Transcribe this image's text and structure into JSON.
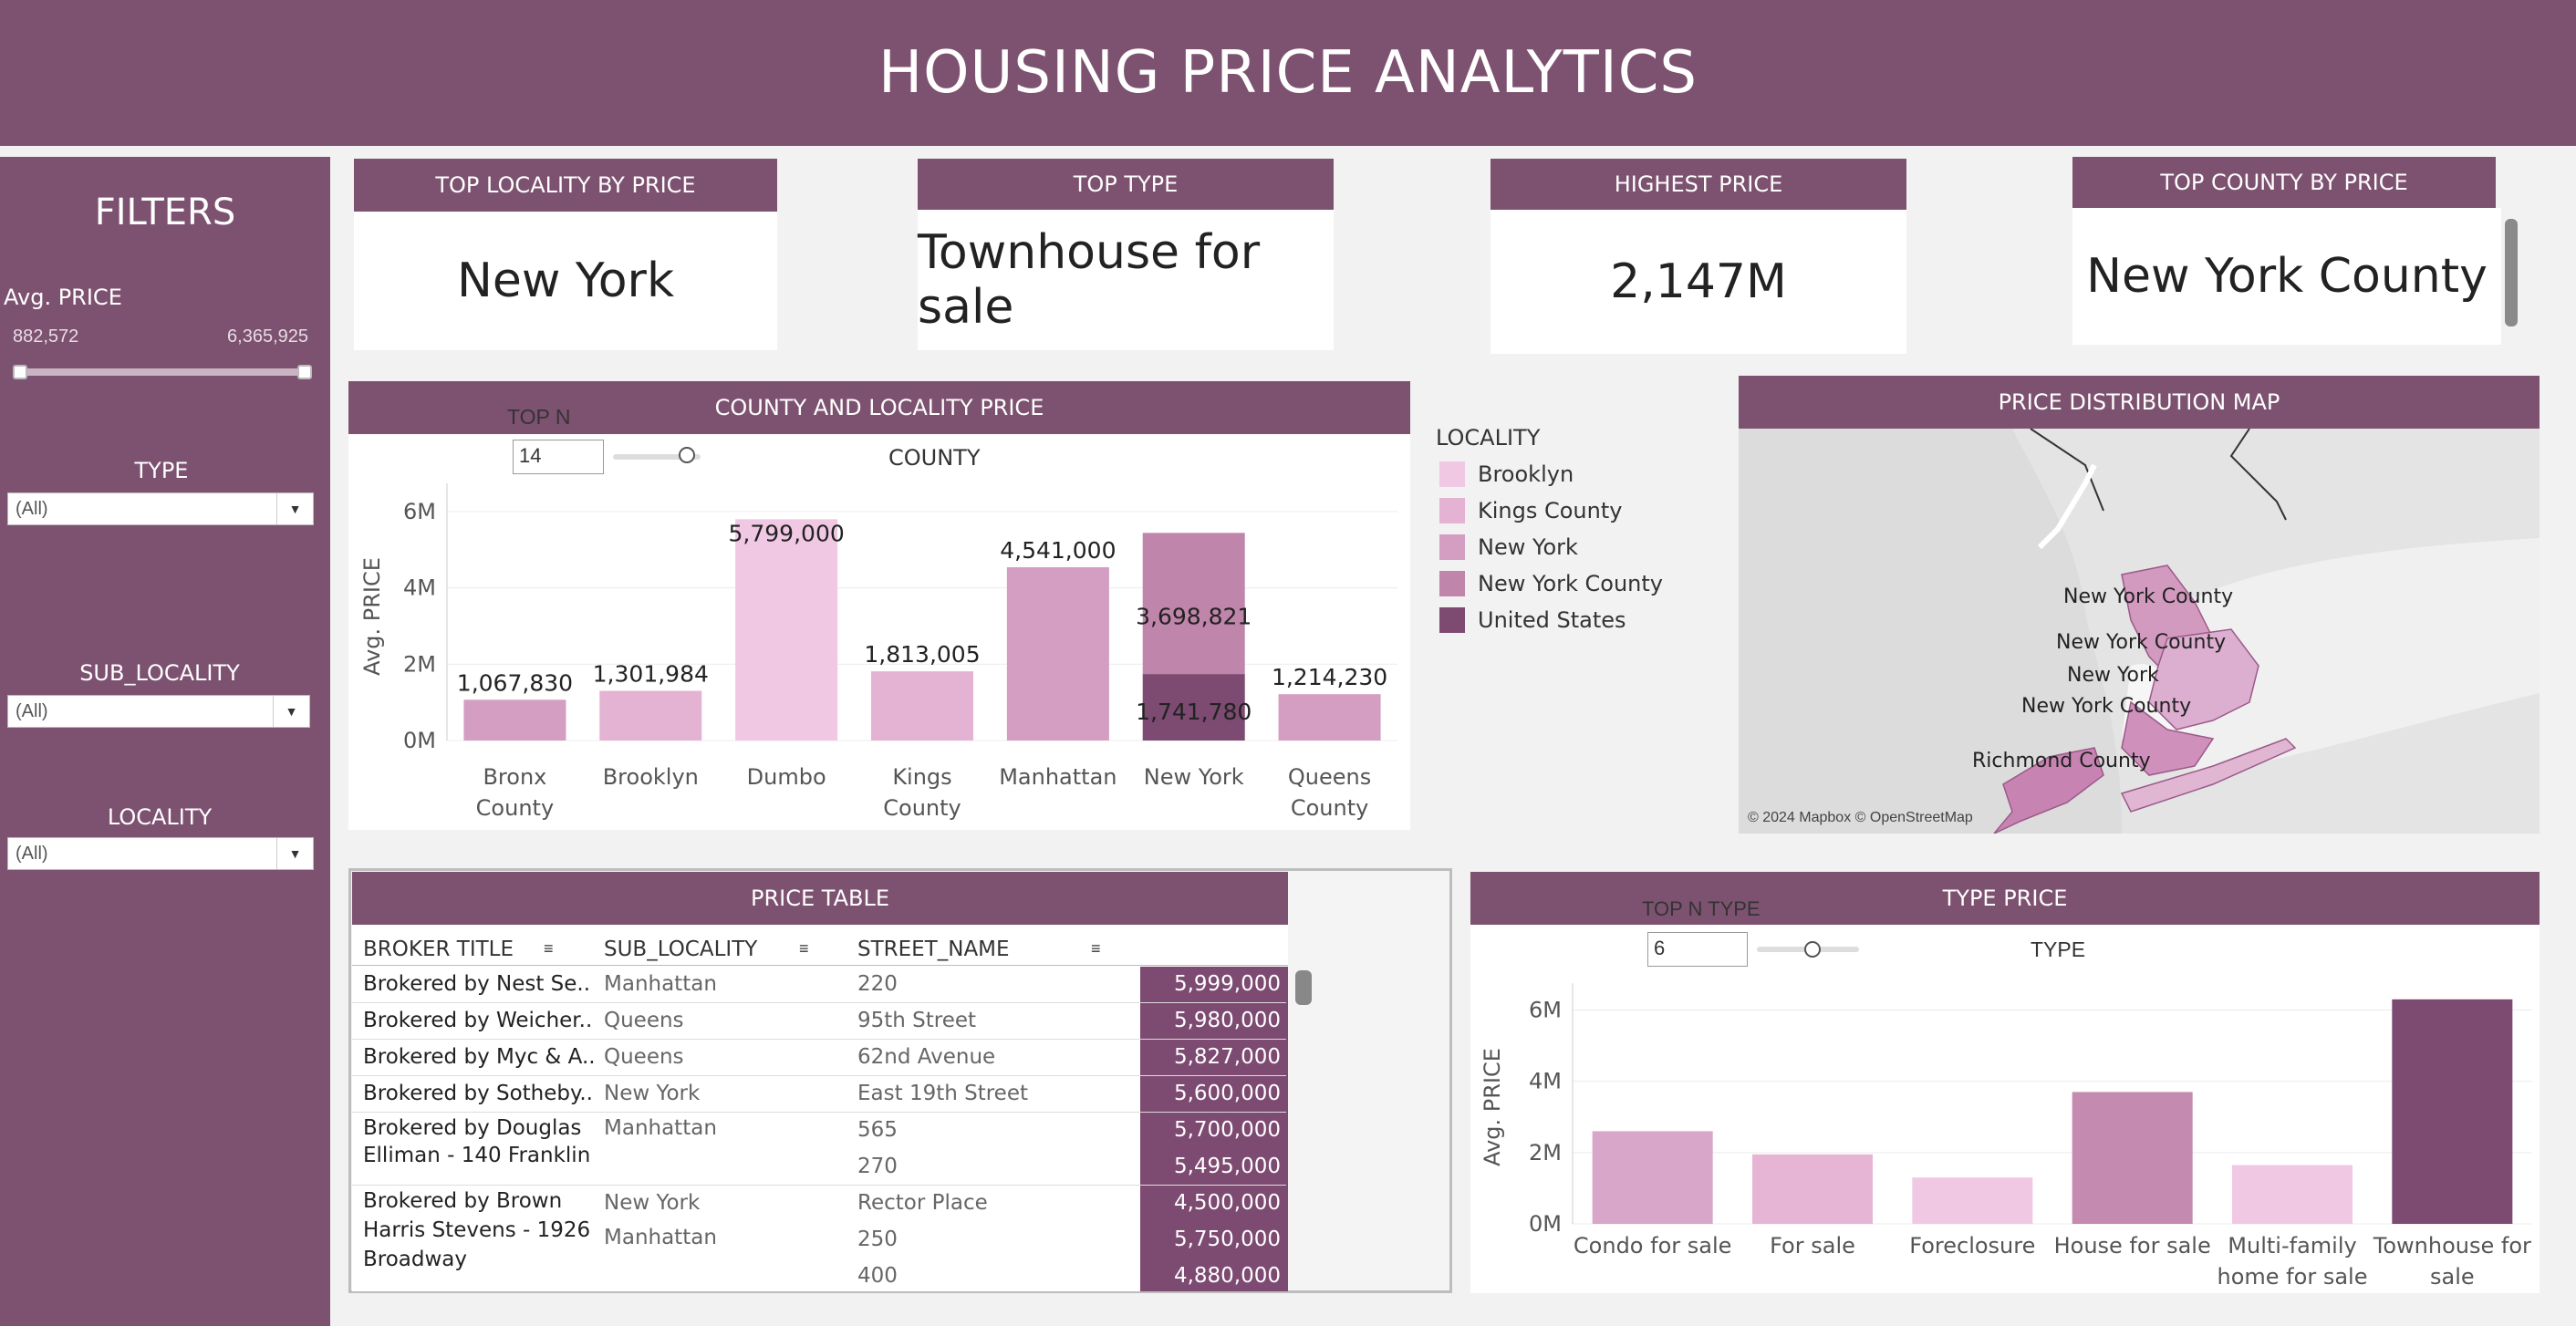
{
  "header": {
    "title": "HOUSING PRICE ANALYTICS"
  },
  "sidebar": {
    "title": "FILTERS",
    "price": {
      "label": "Avg. PRICE",
      "min": "882,572",
      "max": "6,365,925"
    },
    "type": {
      "label": "TYPE",
      "value": "(All)"
    },
    "sub_locality": {
      "label": "SUB_LOCALITY",
      "value": "(All)"
    },
    "locality": {
      "label": "LOCALITY",
      "value": "(All)"
    }
  },
  "kpis": [
    {
      "label": "TOP LOCALITY BY PRICE",
      "value": "New York"
    },
    {
      "label": "TOP TYPE",
      "value": "Townhouse for sale"
    },
    {
      "label": "HIGHEST PRICE",
      "value": "2,147M"
    },
    {
      "label": "TOP COUNTY BY PRICE",
      "value": "New York County"
    }
  ],
  "county_panel": {
    "title": "COUNTY AND LOCALITY PRICE",
    "top_n_label": "TOP N",
    "top_n_value": "14",
    "axis_title": "COUNTY"
  },
  "legend": {
    "title": "LOCALITY",
    "items": [
      {
        "name": "Brooklyn",
        "color": "#f0c8e4"
      },
      {
        "name": "Kings County",
        "color": "#e4b3d3"
      },
      {
        "name": "New York",
        "color": "#d49dc2"
      },
      {
        "name": "New York County",
        "color": "#bf85ab"
      },
      {
        "name": "United States",
        "color": "#7d4a72"
      }
    ]
  },
  "map": {
    "title": "PRICE DISTRIBUTION MAP",
    "labels": [
      "New York County",
      "New York County",
      "New York",
      "New York County",
      "Richmond County"
    ],
    "attribution": "© 2024 Mapbox © OpenStreetMap"
  },
  "table": {
    "title": "PRICE TABLE",
    "columns": [
      "BROKER TITLE",
      "SUB_LOCALITY",
      "STREET_NAME"
    ],
    "rows": [
      {
        "broker": "Brokered by Nest Se..",
        "sub": "Manhattan",
        "street": "220",
        "price": "5,999,000"
      },
      {
        "broker": "Brokered by Weicher..",
        "sub": "Queens",
        "street": "95th Street",
        "price": "5,980,000"
      },
      {
        "broker": "Brokered by Myc & A..",
        "sub": "Queens",
        "street": "62nd Avenue",
        "price": "5,827,000"
      },
      {
        "broker": "Brokered by Sotheby..",
        "sub": "New York",
        "street": "East 19th Street",
        "price": "5,600,000"
      },
      {
        "broker": "Brokered by Douglas",
        "broker2": "Elliman - 140 Franklin",
        "sub": "Manhattan",
        "street": "565",
        "street2": "270",
        "price": "5,700,000",
        "price2": "5,495,000"
      },
      {
        "broker": "Brokered by Brown",
        "broker2": "Harris Stevens - 1926",
        "broker3": "Broadway",
        "sub": "New York",
        "sub2": "Manhattan",
        "street": "Rector Place",
        "street2": "250",
        "street3": "400",
        "price": "4,500,000",
        "price2": "5,750,000",
        "price3": "4,880,000"
      }
    ]
  },
  "type_panel": {
    "title": "TYPE PRICE",
    "top_n_label": "TOP N TYPE",
    "top_n_value": "6",
    "axis_title": "TYPE"
  },
  "chart_data": [
    {
      "type": "bar",
      "title": "COUNTY AND LOCALITY PRICE",
      "xlabel": "COUNTY",
      "ylabel": "Avg. PRICE",
      "ylim": [
        0,
        6500000
      ],
      "yticks": [
        "0M",
        "2M",
        "4M",
        "6M"
      ],
      "categories": [
        "Bronx County",
        "Brooklyn",
        "Dumbo",
        "Kings County",
        "Manhattan",
        "New York",
        "Queens County"
      ],
      "bars": [
        {
          "category": "Bronx County",
          "value": 1067830,
          "label": "1,067,830",
          "color": "#d49dc2"
        },
        {
          "category": "Brooklyn",
          "value": 1301984,
          "label": "1,301,984",
          "color": "#e4b3d3"
        },
        {
          "category": "Dumbo",
          "value": 5799000,
          "label": "5,799,000",
          "color": "#f0c8e4"
        },
        {
          "category": "Kings County",
          "value": 1813005,
          "label": "1,813,005",
          "color": "#e4b3d3"
        },
        {
          "category": "Manhattan",
          "value": 4541000,
          "label": "4,541,000",
          "color": "#d49dc2"
        },
        {
          "category": "New York",
          "value": 3698821,
          "label": "3,698,821",
          "color": "#bf85ab",
          "stack": "top"
        },
        {
          "category": "New York",
          "value": 1741780,
          "label": "1,741,780",
          "color": "#7d4a72",
          "stack": "bottom"
        },
        {
          "category": "Queens County",
          "value": 1214230,
          "label": "1,214,230",
          "color": "#d49dc2"
        }
      ]
    },
    {
      "type": "bar",
      "title": "TYPE PRICE",
      "xlabel": "TYPE",
      "ylabel": "Avg. PRICE",
      "ylim": [
        0,
        6500000
      ],
      "yticks": [
        "0M",
        "2M",
        "4M",
        "6M"
      ],
      "categories": [
        "Condo for sale",
        "For sale",
        "Foreclosure",
        "House for sale",
        "Multi-family home for sale",
        "Townhouse for sale"
      ],
      "values": [
        2600000,
        1950000,
        1300000,
        3700000,
        1650000,
        6300000
      ],
      "colors": [
        "#d8a6c9",
        "#e6b5d6",
        "#f0c8e4",
        "#c48aaf",
        "#f0c8e4",
        "#7d4a72"
      ]
    }
  ]
}
